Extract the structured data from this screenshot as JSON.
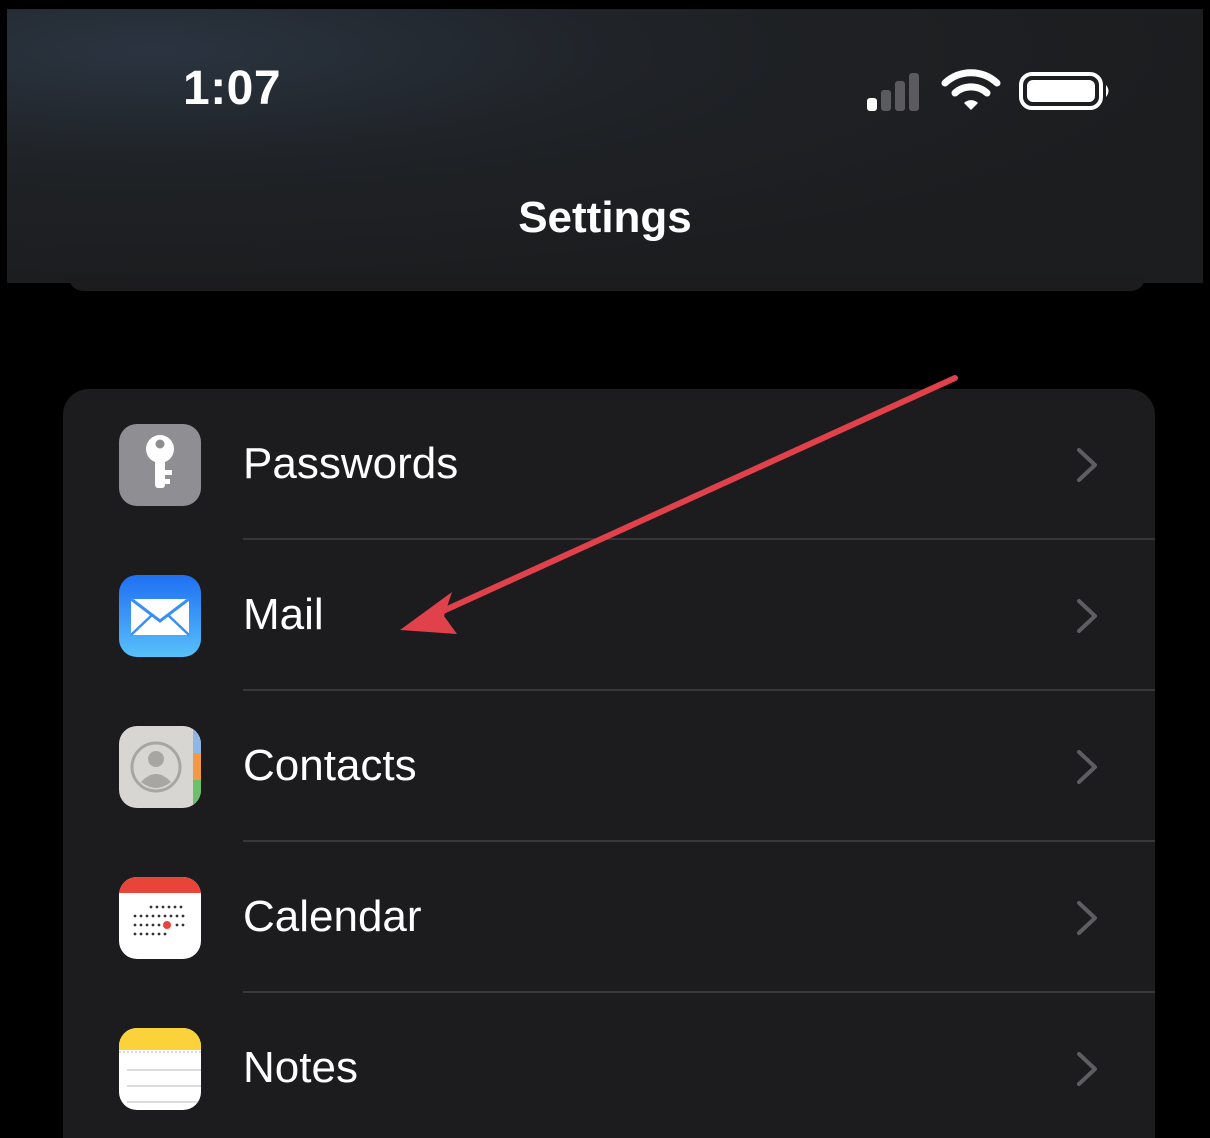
{
  "status_bar": {
    "time": "1:07",
    "icons": [
      "signal-icon",
      "wifi-icon",
      "battery-icon"
    ]
  },
  "nav": {
    "title": "Settings"
  },
  "settings_rows": [
    {
      "label": "Passwords",
      "icon": "key-icon",
      "icon_color": "#8e8e93"
    },
    {
      "label": "Mail",
      "icon": "mail-icon",
      "icon_color": "#2f8af5"
    },
    {
      "label": "Contacts",
      "icon": "contacts-icon",
      "icon_color": "#d8d6d2"
    },
    {
      "label": "Calendar",
      "icon": "calendar-icon",
      "icon_color": "#ffffff"
    },
    {
      "label": "Notes",
      "icon": "notes-icon",
      "icon_color": "#fbd23a"
    }
  ],
  "annotation": {
    "type": "arrow",
    "color": "#e0414a",
    "points_to": "Mail"
  },
  "colors": {
    "background": "#000000",
    "group_background": "#1c1c1e",
    "separator": "#38383a",
    "chevron": "#5e5e62"
  }
}
